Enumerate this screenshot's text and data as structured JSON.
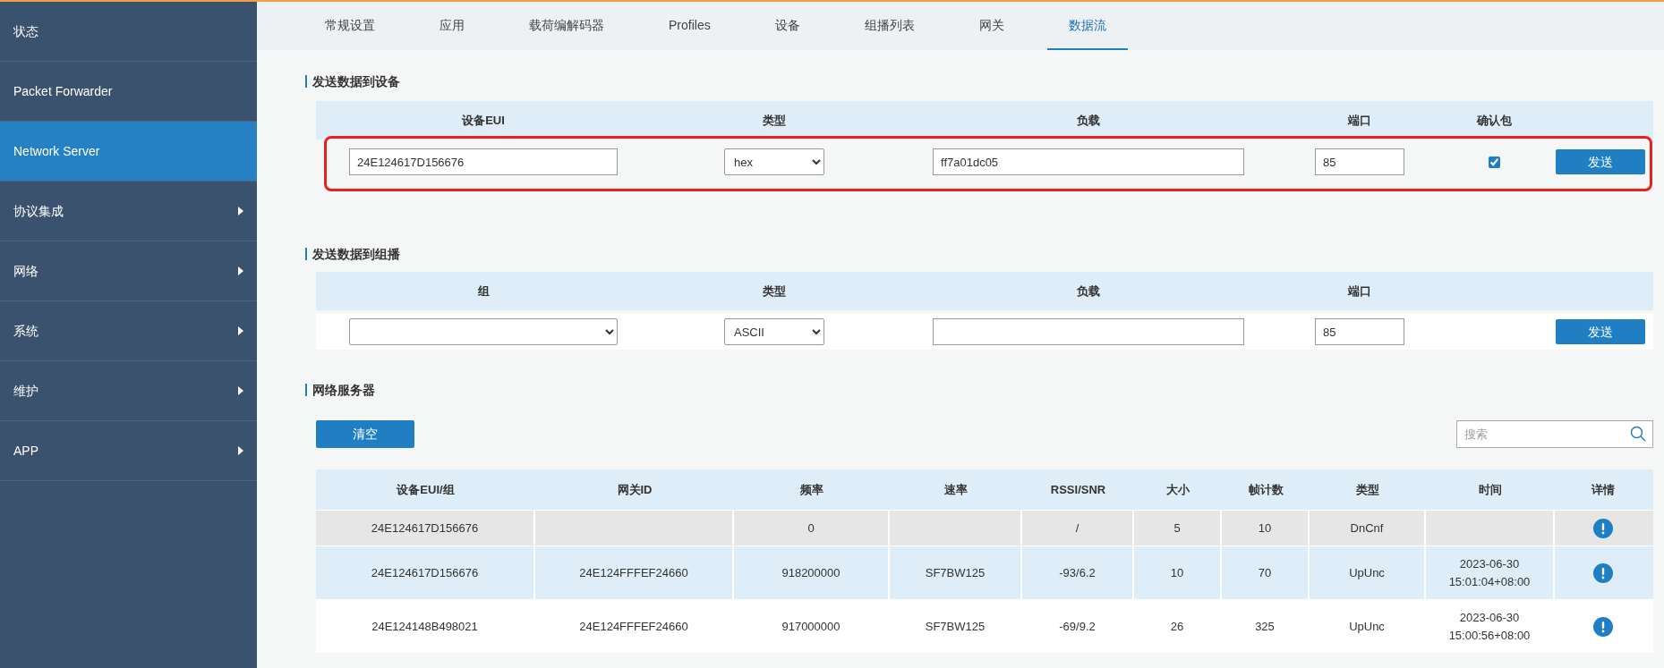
{
  "sidebar": {
    "items": [
      {
        "label": "状态",
        "has_arrow": false,
        "selected": false
      },
      {
        "label": "Packet Forwarder",
        "has_arrow": false,
        "selected": false
      },
      {
        "label": "Network Server",
        "has_arrow": false,
        "selected": true
      },
      {
        "label": "协议集成",
        "has_arrow": true,
        "selected": false
      },
      {
        "label": "网络",
        "has_arrow": true,
        "selected": false
      },
      {
        "label": "系统",
        "has_arrow": true,
        "selected": false
      },
      {
        "label": "维护",
        "has_arrow": true,
        "selected": false
      },
      {
        "label": "APP",
        "has_arrow": true,
        "selected": false
      }
    ]
  },
  "tabs": [
    {
      "label": "常规设置",
      "selected": false
    },
    {
      "label": "应用",
      "selected": false
    },
    {
      "label": "载荷编解码器",
      "selected": false
    },
    {
      "label": "Profiles",
      "selected": false
    },
    {
      "label": "设备",
      "selected": false
    },
    {
      "label": "组播列表",
      "selected": false
    },
    {
      "label": "网关",
      "selected": false
    },
    {
      "label": "数据流",
      "selected": true
    }
  ],
  "device_section": {
    "title": "发送数据到设备",
    "highlighted": true,
    "columns": [
      "设备EUI",
      "类型",
      "负载",
      "端口",
      "确认包"
    ],
    "eui": "24E124617D156676",
    "type": "hex",
    "payload": "ff7a01dc05",
    "port": "85",
    "confirmed": true,
    "button": "发送"
  },
  "group_section": {
    "title": "发送数据到组播",
    "columns": [
      "组",
      "类型",
      "负载",
      "端口"
    ],
    "type": "ASCII",
    "port": "85",
    "button": "发送"
  },
  "server_section": {
    "title": "网络服务器",
    "clear_button": "清空",
    "search_placeholder": "搜索",
    "table": {
      "columns": [
        "设备EUI/组",
        "网关ID",
        "频率",
        "速率",
        "RSSI/SNR",
        "大小",
        "帧计数",
        "类型",
        "时间",
        "详情"
      ],
      "rows": [
        {
          "selected": true,
          "cells": [
            "24E124617D156676",
            "",
            "0",
            "",
            "/",
            "5",
            "10",
            "DnCnf",
            []
          ]
        },
        {
          "selected": false,
          "cells": [
            "24E124617D156676",
            "24E124FFFEF24660",
            "918200000",
            "SF7BW125",
            "-93/6.2",
            "10",
            "70",
            "UpUnc",
            [
              "2023-06-30",
              "15:01:04+08:00"
            ]
          ]
        },
        {
          "selected": false,
          "cells": [
            "24E124148B498021",
            "24E124FFFEF24660",
            "917000000",
            "SF7BW125",
            "-69/9.2",
            "26",
            "325",
            "UpUnc",
            [
              "2023-06-30",
              "15:00:56+08:00"
            ]
          ]
        }
      ]
    }
  }
}
